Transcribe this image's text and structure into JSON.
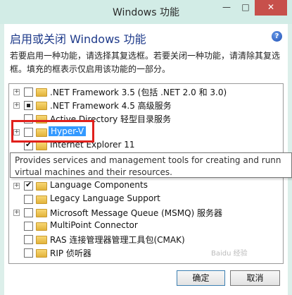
{
  "window": {
    "title": "Windows 功能",
    "min_symbol": "—",
    "max_symbol": "□",
    "close_symbol": "✕"
  },
  "heading": "启用或关闭 Windows 功能",
  "help_symbol": "?",
  "description": "若要启用一种功能，请选择其复选框。若要关闭一种功能，请清除其复选框。填充的框表示仅启用该功能的一部分。",
  "features": [
    {
      "label": ".NET Framework 3.5 (包括 .NET 2.0 和 3.0)",
      "expandable": true,
      "state": "unchecked"
    },
    {
      "label": ".NET Framework 4.5 高级服务",
      "expandable": true,
      "state": "partial"
    },
    {
      "label": "Active Directory 轻型目录服务",
      "expandable": false,
      "state": "unchecked"
    },
    {
      "label": "Hyper-V",
      "expandable": true,
      "state": "unchecked",
      "selected": true
    },
    {
      "label": "Internet Explorer 11",
      "expandable": false,
      "state": "checked"
    },
    {
      "label": "",
      "expandable": true,
      "state": "unchecked"
    },
    {
      "label": "",
      "expandable": false,
      "state": "unchecked"
    },
    {
      "label": "Language Components",
      "expandable": true,
      "state": "checked"
    },
    {
      "label": "Legacy Language Support",
      "expandable": false,
      "state": "unchecked"
    },
    {
      "label": "Microsoft Message Queue (MSMQ) 服务器",
      "expandable": true,
      "state": "unchecked"
    },
    {
      "label": "MultiPoint Connector",
      "expandable": false,
      "state": "unchecked"
    },
    {
      "label": "RAS 连接管理器管理工具包(CMAK)",
      "expandable": false,
      "state": "unchecked"
    },
    {
      "label": "RIP 侦听器",
      "expandable": false,
      "state": "unchecked"
    }
  ],
  "tooltip": {
    "line1": "Provides services and management tools for creating and runn",
    "line2": "virtual machines and their resources."
  },
  "buttons": {
    "ok": "确定",
    "cancel": "取消"
  },
  "watermark": "Baidu 经验"
}
